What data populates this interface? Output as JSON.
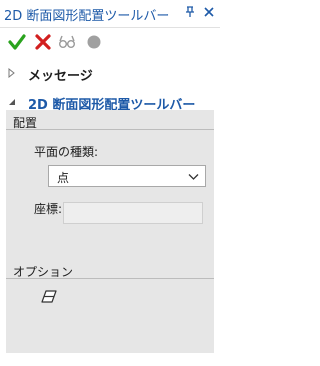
{
  "window": {
    "title": "2D 断面図形配置ツールバー",
    "pin_icon": "pin-icon",
    "close_icon": "close-icon"
  },
  "toolbar": {
    "buttons": [
      {
        "name": "ok",
        "icon": "check-icon",
        "color": "#2aa31e"
      },
      {
        "name": "cancel",
        "icon": "x-icon",
        "color": "#d21f1f"
      },
      {
        "name": "preview",
        "icon": "glasses-icon",
        "color": "#9a9a9a"
      },
      {
        "name": "pause",
        "icon": "circle-icon",
        "color": "#9a9a9a"
      }
    ]
  },
  "tree": {
    "messages_label": "メッセージ",
    "config_label": "2D 断面図形配置ツールバー"
  },
  "sections": {
    "placement": {
      "title": "配置",
      "plane_type_label": "平面の種類:",
      "plane_type_value": "点",
      "coordinates_label": "座標:",
      "coordinates_value": ""
    },
    "options": {
      "title": "オプション",
      "eraser_icon": "eraser-icon"
    }
  },
  "colors": {
    "accent": "#1e5aa8",
    "panel_bg": "#e6e6e6"
  }
}
